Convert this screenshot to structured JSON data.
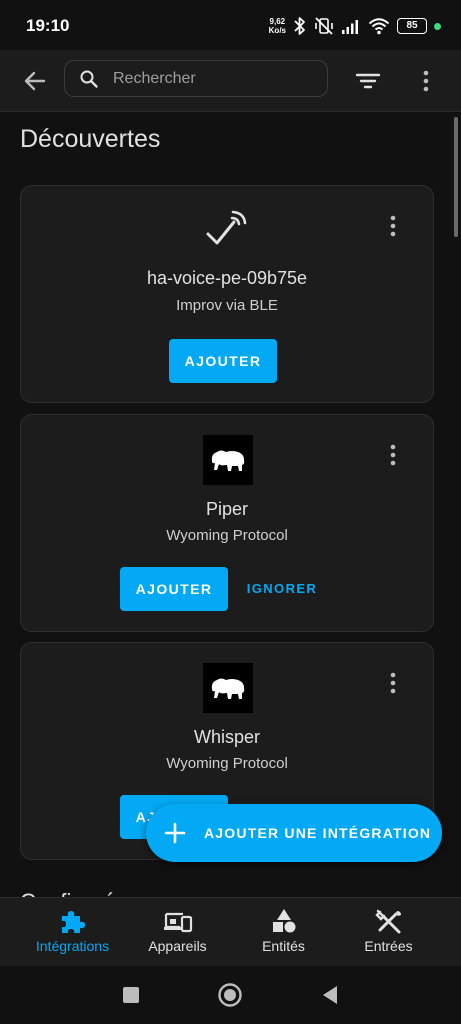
{
  "status_bar": {
    "time": "19:10",
    "speed_value": "9,62",
    "speed_unit": "Ko/s",
    "battery": "85"
  },
  "app_bar": {
    "search_placeholder": "Rechercher"
  },
  "section": {
    "title": "Découvertes",
    "next_title_partial": "Configurée"
  },
  "cards": [
    {
      "name": "ha-voice-pe-09b75e",
      "subtitle": "Improv via BLE",
      "icon": "bluetooth-connect-icon",
      "primary_label": "AJOUTER"
    },
    {
      "name": "Piper",
      "subtitle": "Wyoming Protocol",
      "icon": "wyoming-bison-logo",
      "primary_label": "AJOUTER",
      "secondary_label": "IGNORER"
    },
    {
      "name": "Whisper",
      "subtitle": "Wyoming Protocol",
      "icon": "wyoming-bison-logo",
      "primary_label": "AJOUTER"
    }
  ],
  "fab": {
    "label": "AJOUTER UNE INTÉGRATION"
  },
  "bottom_nav": [
    {
      "label": "Intégrations",
      "icon": "puzzle-icon",
      "active": true
    },
    {
      "label": "Appareils",
      "icon": "devices-icon",
      "active": false
    },
    {
      "label": "Entités",
      "icon": "shapes-icon",
      "active": false
    },
    {
      "label": "Entrées",
      "icon": "tools-icon",
      "active": false
    }
  ],
  "colors": {
    "accent": "#03a9f4",
    "background": "#111111",
    "surface": "#1c1c1c"
  }
}
